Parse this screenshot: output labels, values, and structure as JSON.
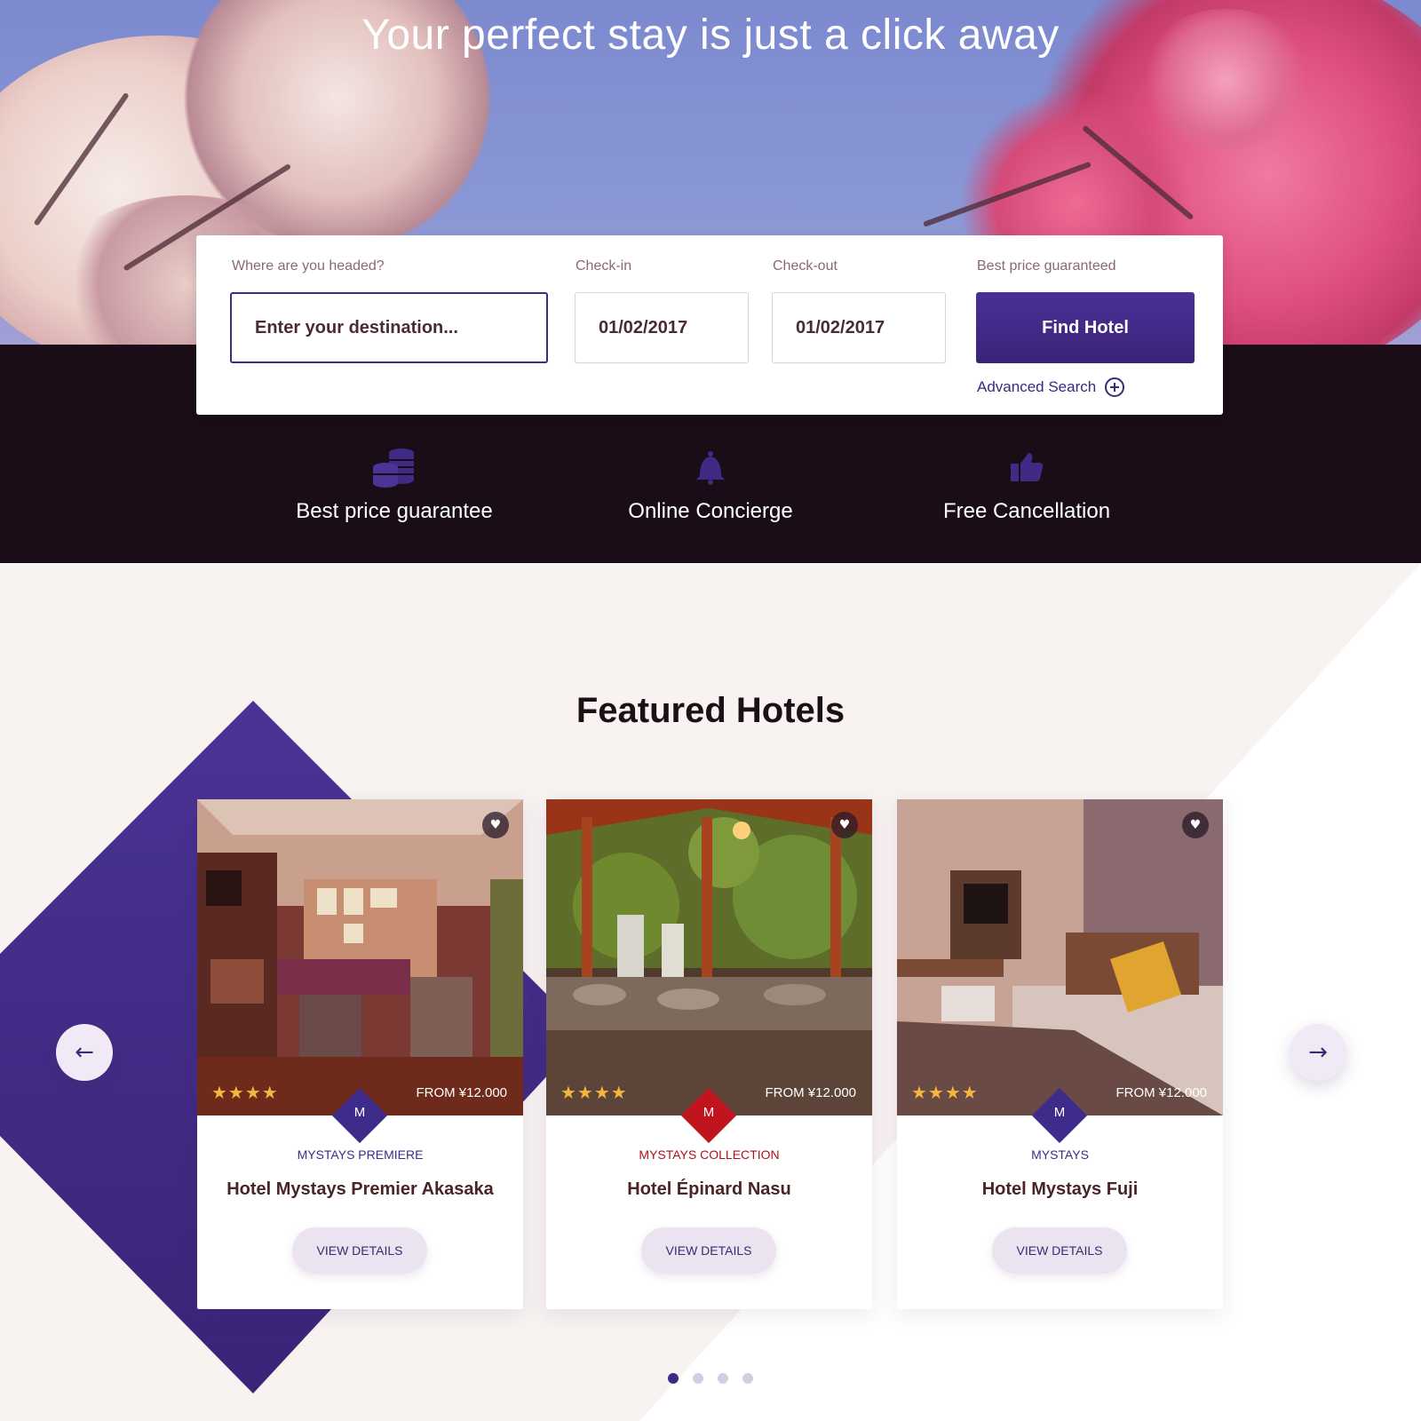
{
  "hero": {
    "title": "Your perfect stay is just a click away"
  },
  "search": {
    "destination_label": "Where are you headed?",
    "destination_placeholder": "Enter your destination...",
    "checkin_label": "Check-in",
    "checkin_value": "01/02/2017",
    "checkout_label": "Check-out",
    "checkout_value": "01/02/2017",
    "price_label": "Best price guaranteed",
    "find_button": "Find Hotel",
    "advanced_search": "Advanced Search"
  },
  "features": [
    {
      "label": "Best price guarantee",
      "icon": "coins-icon"
    },
    {
      "label": "Online Concierge",
      "icon": "bell-icon"
    },
    {
      "label": "Free Cancellation",
      "icon": "thumbs-up-icon"
    }
  ],
  "featured": {
    "title": "Featured Hotels",
    "hotels": [
      {
        "brand": "MYSTAYS PREMIERE",
        "name": "Hotel Mystays Premier Akasaka",
        "price": "FROM ¥12.000",
        "stars": "★★★★",
        "badge": "M",
        "badge_color": "#3f2b8a",
        "brand_color": "#3f2b8a",
        "view": "VIEW DETAILS"
      },
      {
        "brand": "MYSTAYS COLLECTION",
        "name": "Hotel Épinard Nasu",
        "price": "FROM ¥12.000",
        "stars": "★★★★",
        "badge": "M",
        "badge_color": "#c0141f",
        "brand_color": "#b0101c",
        "view": "VIEW DETAILS"
      },
      {
        "brand": "MYSTAYS",
        "name": "Hotel Mystays Fuji",
        "price": "FROM ¥12.000",
        "stars": "★★★★",
        "badge": "M",
        "badge_color": "#3f2b8a",
        "brand_color": "#3f2b8a",
        "view": "VIEW DETAILS"
      }
    ]
  },
  "nav": {
    "prev": "←",
    "next": "→"
  },
  "pagination": {
    "count": 4,
    "active": 1
  },
  "colors": {
    "accent": "#3f2b8a",
    "dark_band": "#1b0d18",
    "star": "#f4b63c"
  }
}
